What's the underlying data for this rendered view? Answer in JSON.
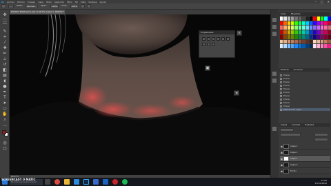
{
  "menu": {
    "app_logo": "Ps",
    "items": [
      "Archivo",
      "Edición",
      "Imagen",
      "Capa",
      "Texto",
      "Selección",
      "Filtro",
      "3D",
      "Vista",
      "Ventana",
      "Ayuda"
    ]
  },
  "window_controls": [
    "–",
    "□",
    "✕"
  ],
  "options_bar": {
    "fields": [
      "Modo:",
      "Normal",
      "Opac.:",
      "100%",
      "Flujo:",
      "100%"
    ]
  },
  "document": {
    "tab_title": "Plantilla Maitharma.psd al 66,7% (Capa 1, RGB/8) *",
    "status": "66,67%"
  },
  "colors": {
    "accent": "#1e6fd9",
    "foreground": "#9b1a1a",
    "background": "#ffffff"
  },
  "right_panel": {
    "swatches_tabs": [
      "Color",
      "Muestras"
    ],
    "history_tabs": [
      "Historia",
      "Acciones"
    ],
    "history_items": [
      "Pincel",
      "Pincel",
      "Pincel",
      "Pincel",
      "Pincel",
      "Pincel",
      "Pincel",
      "Pincel",
      "Pincel",
      "Pincel",
      "Máscara de capa"
    ],
    "layers_tabs": [
      "Capas",
      "Canales",
      "Trazados"
    ],
    "layers": [
      {
        "name": "Capa 1"
      },
      {
        "name": "Capa 1"
      },
      {
        "name": "Capa 1"
      },
      {
        "name": "Capa 2"
      },
      {
        "name": "Fondo"
      }
    ]
  },
  "float_panel": {
    "title": "Propiedades"
  },
  "taskbar": {
    "search_placeholder": "Escribe aquí para buscar",
    "watermark": "SCREENCAST O MATIC",
    "time": "12:06",
    "date": "13/10/2020"
  }
}
